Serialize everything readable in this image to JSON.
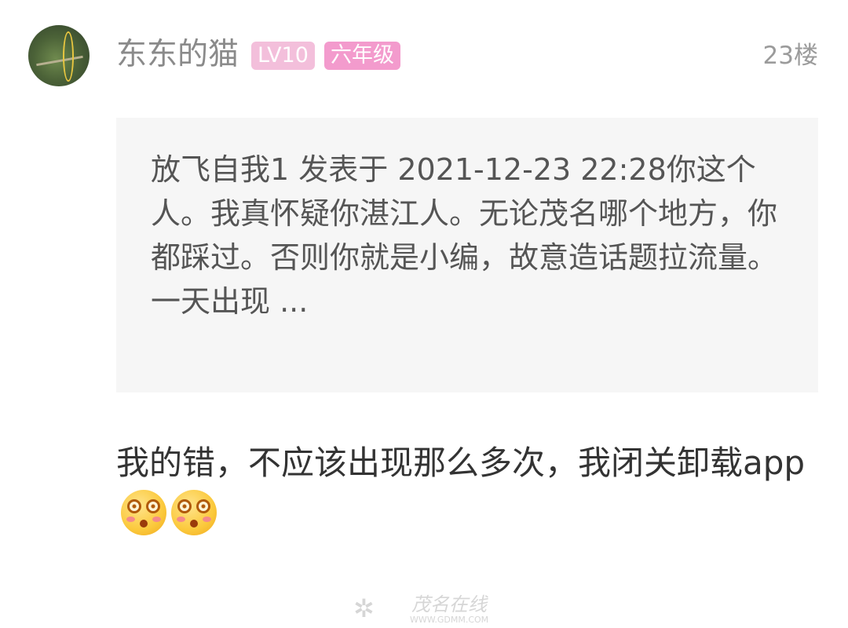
{
  "post": {
    "username": "东东的猫",
    "level_badge": "LV10",
    "grade_badge": "六年级",
    "floor": "23楼",
    "quote": "放飞自我1 发表于 2021-12-23 22:28你这个人。我真怀疑你湛江人。无论茂名哪个地方，你都踩过。否则你就是小编，故意造话题拉流量。一天出现 ...",
    "reply": "我的错，不应该出现那么多次，我闭关卸载app",
    "reply_emojis": [
      "dizzy-face-emoji",
      "dizzy-face-emoji"
    ]
  },
  "colors": {
    "level_badge_bg": "#f3bfdb",
    "grade_badge_bg": "#f39bcd",
    "quote_bg": "#f6f6f6"
  },
  "watermark": {
    "name": "茂名在线",
    "url": "WWW.GDMM.COM"
  }
}
